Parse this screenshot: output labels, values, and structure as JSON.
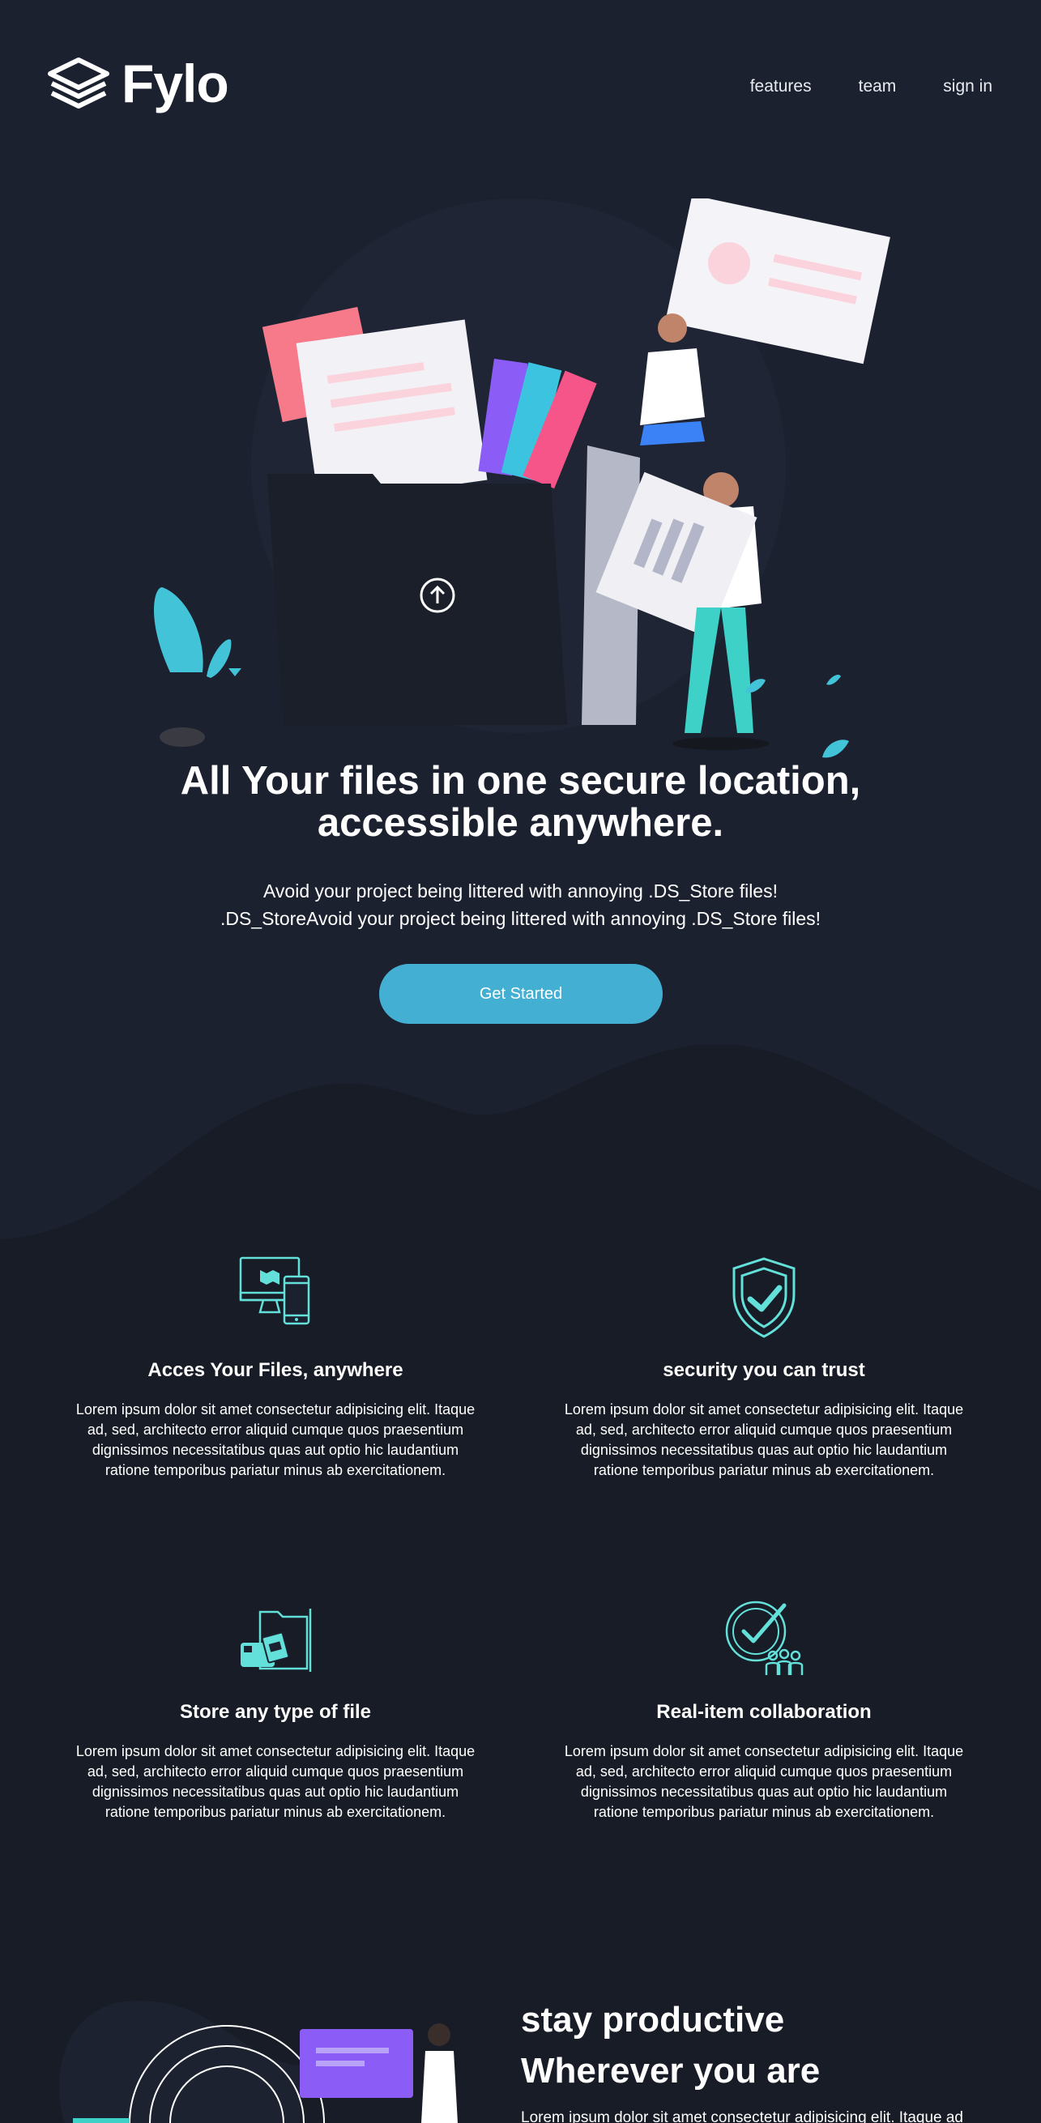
{
  "header": {
    "logo_text": "Fylo",
    "nav": [
      "features",
      "team",
      "sign in"
    ]
  },
  "hero": {
    "title_line1": "All Your files in one secure location,",
    "title_line2": "accessible anywhere.",
    "subtitle_line1": "Avoid your project being littered with annoying .DS_Store files!",
    "subtitle_line2": ".DS_StoreAvoid your project being littered with annoying .DS_Store files!",
    "cta_label": "Get Started"
  },
  "features": [
    {
      "icon": "access-anywhere-icon",
      "title": "Acces Your Files, anywhere",
      "text": "Lorem ipsum dolor sit amet consectetur adipisicing elit. Itaque ad, sed, architecto error aliquid cumque quos praesentium dignissimos necessitatibus quas aut optio hic laudantium ratione temporibus pariatur minus ab exercitationem."
    },
    {
      "icon": "security-shield-icon",
      "title": "security you can trust",
      "text": "Lorem ipsum dolor sit amet consectetur adipisicing elit. Itaque ad, sed, architecto error aliquid cumque quos praesentium dignissimos necessitatibus quas aut optio hic laudantium ratione temporibus pariatur minus ab exercitationem."
    },
    {
      "icon": "any-file-type-icon",
      "title": "Store any type of file",
      "text": "Lorem ipsum dolor sit amet consectetur adipisicing elit. Itaque ad, sed, architecto error aliquid cumque quos praesentium dignissimos necessitatibus quas aut optio hic laudantium ratione temporibus pariatur minus ab exercitationem."
    },
    {
      "icon": "collaboration-icon",
      "title": "Real-item collaboration",
      "text": "Lorem ipsum dolor sit amet consectetur adipisicing elit. Itaque ad, sed, architecto error aliquid cumque quos praesentium dignissimos necessitatibus quas aut optio hic laudantium ratione temporibus pariatur minus ab exercitationem."
    }
  ],
  "productive": {
    "title_line1": "stay productive",
    "title_line2": "Wherever you are",
    "text": "Lorem ipsum dolor sit amet consectetur adipisicing elit. Itaque ad"
  },
  "colors": {
    "background": "#1c2130",
    "background_lower": "#181c26",
    "accent": "#43afd3",
    "icon_teal": "#62e0d9"
  }
}
